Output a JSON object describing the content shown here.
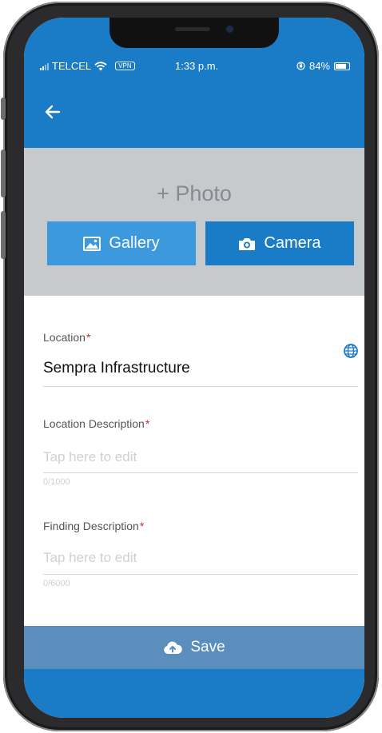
{
  "status_bar": {
    "carrier": "TELCEL",
    "vpn": "VPN",
    "time": "1:33 p.m.",
    "battery": "84%",
    "battery_level": 0.84
  },
  "header": {
    "back_icon": "arrow-left-icon"
  },
  "photo": {
    "add_label": "+ Photo",
    "gallery_label": "Gallery",
    "camera_label": "Camera"
  },
  "form": {
    "location": {
      "label": "Location",
      "required_mark": "*",
      "value": "Sempra Infrastructure",
      "icon": "globe-icon"
    },
    "location_description": {
      "label": "Location Description",
      "required_mark": "*",
      "placeholder": "Tap here to edit",
      "counter": "0/1000"
    },
    "finding_description": {
      "label": "Finding Description",
      "required_mark": "*",
      "placeholder": "Tap here to edit",
      "counter": "0/6000"
    }
  },
  "save": {
    "label": "Save",
    "icon": "cloud-upload-icon"
  },
  "colors": {
    "primary": "#1a7cc6",
    "gallery_button": "#3d99dd",
    "save_bar": "#5b8dbd",
    "required": "#dd2222"
  }
}
